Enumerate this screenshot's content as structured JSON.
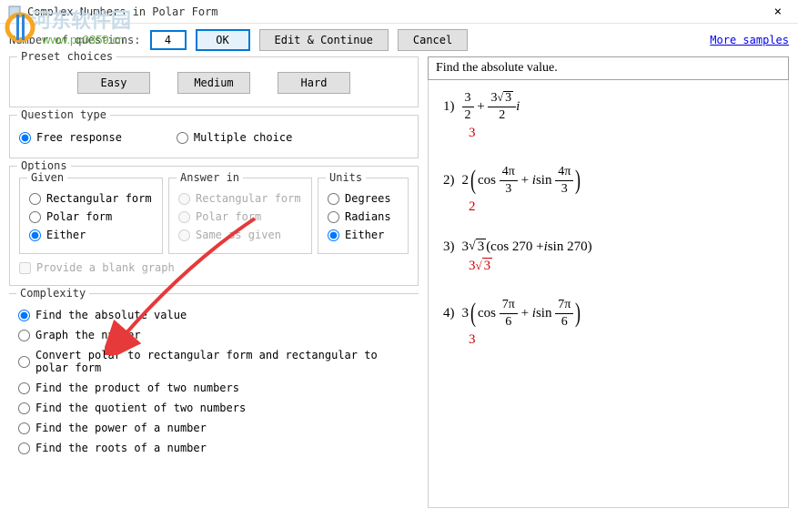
{
  "window": {
    "title": "Complex Numbers in Polar Form",
    "close": "×"
  },
  "watermark": {
    "text1": "河东软件园",
    "text2": "www.pc0359.cn"
  },
  "toolbar": {
    "num_questions_label": "Number of questions:",
    "num_questions_value": "4",
    "ok": "OK",
    "edit_continue": "Edit & Continue",
    "cancel": "Cancel",
    "more_samples": "More samples"
  },
  "preset": {
    "legend": "Preset choices",
    "easy": "Easy",
    "medium": "Medium",
    "hard": "Hard"
  },
  "qtype": {
    "legend": "Question type",
    "free": "Free response",
    "multiple": "Multiple choice"
  },
  "options": {
    "legend": "Options",
    "given": {
      "legend": "Given",
      "rect": "Rectangular form",
      "polar": "Polar form",
      "either": "Either"
    },
    "answer": {
      "legend": "Answer in",
      "rect": "Rectangular form",
      "polar": "Polar form",
      "same": "Same as given"
    },
    "units": {
      "legend": "Units",
      "deg": "Degrees",
      "rad": "Radians",
      "either": "Either"
    },
    "blank_graph": "Provide a blank graph"
  },
  "complexity": {
    "legend": "Complexity",
    "items": [
      "Find the absolute value",
      "Graph the number",
      "Convert polar to rectangular form and rectangular to polar form",
      "Find the product of two numbers",
      "Find the quotient of two numbers",
      "Find the power of a number",
      "Find the roots of a number"
    ]
  },
  "preview": {
    "header": "Find the absolute value.",
    "p1_num": "1)",
    "p1_ans": "3",
    "p2_num": "2)",
    "p2_ans": "2",
    "p3_num": "3)",
    "p3_expr_a": "(cos 270 + ",
    "p3_expr_b": "sin 270)",
    "p4_num": "4)",
    "p4_ans": "3"
  }
}
